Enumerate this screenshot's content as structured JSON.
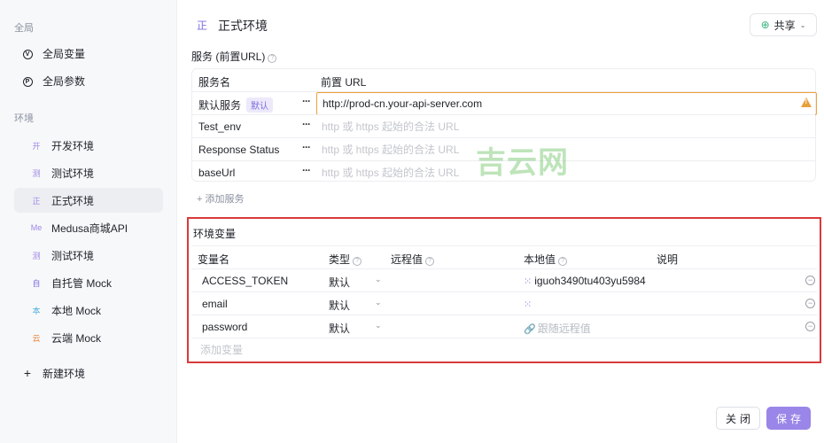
{
  "sidebar": {
    "global_section": "全局",
    "global_items": [
      {
        "label": "全局变量",
        "icon": "variable-icon",
        "glyph": "V"
      },
      {
        "label": "全局参数",
        "icon": "parameter-icon",
        "glyph": "P"
      }
    ],
    "env_section": "环境",
    "environments": [
      {
        "badge": "开",
        "label": "开发环境",
        "color": "#9f87e6",
        "active": false
      },
      {
        "badge": "测",
        "label": "测试环境",
        "color": "#9f87e6",
        "active": false
      },
      {
        "badge": "正",
        "label": "正式环境",
        "color": "#9f87e6",
        "active": true
      },
      {
        "badge": "Me",
        "label": "Medusa商城API",
        "color": "#9f87e6",
        "active": false
      },
      {
        "badge": "测",
        "label": "测试环境",
        "color": "#9f87e6",
        "active": false
      },
      {
        "badge": "自",
        "label": "自托管 Mock",
        "color": "#7b6fe0",
        "active": false
      },
      {
        "badge": "本",
        "label": "本地 Mock",
        "color": "#4ab0d8",
        "active": false
      },
      {
        "badge": "云",
        "label": "云端 Mock",
        "color": "#e8853c",
        "active": false
      }
    ],
    "new_env": "新建环境"
  },
  "header": {
    "badge": "正",
    "title": "正式环境",
    "share_label": "共享"
  },
  "services": {
    "section_label": "服务 (前置URL)",
    "col_name": "服务名",
    "col_url": "前置 URL",
    "default_tag": "默认",
    "placeholder": "http 或 https 起始的合法 URL",
    "rows": [
      {
        "name": "默认服务",
        "is_default": true,
        "url": "http://prod-cn.your-api-server.com"
      },
      {
        "name": "Test_env",
        "is_default": false,
        "url": ""
      },
      {
        "name": "Response Status",
        "is_default": false,
        "url": ""
      },
      {
        "name": "baseUrl",
        "is_default": false,
        "url": ""
      }
    ],
    "add_label": "+ 添加服务"
  },
  "env_vars": {
    "section_label": "环境变量",
    "columns": {
      "name": "变量名",
      "type": "类型",
      "remote": "远程值",
      "local": "本地值",
      "desc": "说明"
    },
    "rows": [
      {
        "name": "ACCESS_TOKEN",
        "type": "默认",
        "remote": "",
        "local": "iguoh3490tu403yu5984",
        "desc": ""
      },
      {
        "name": "email",
        "type": "默认",
        "remote": "",
        "local": "",
        "desc": ""
      },
      {
        "name": "password",
        "type": "默认",
        "remote": "",
        "local": "跟随远程值",
        "desc": ""
      }
    ],
    "add_placeholder": "添加变量"
  },
  "footer": {
    "close_label": "关闭",
    "save_label": "保存"
  },
  "watermark": "吉云网",
  "colors": {
    "accent": "#9a86e8",
    "warning": "#f0a03a",
    "highlight_border": "#d93a3a"
  }
}
